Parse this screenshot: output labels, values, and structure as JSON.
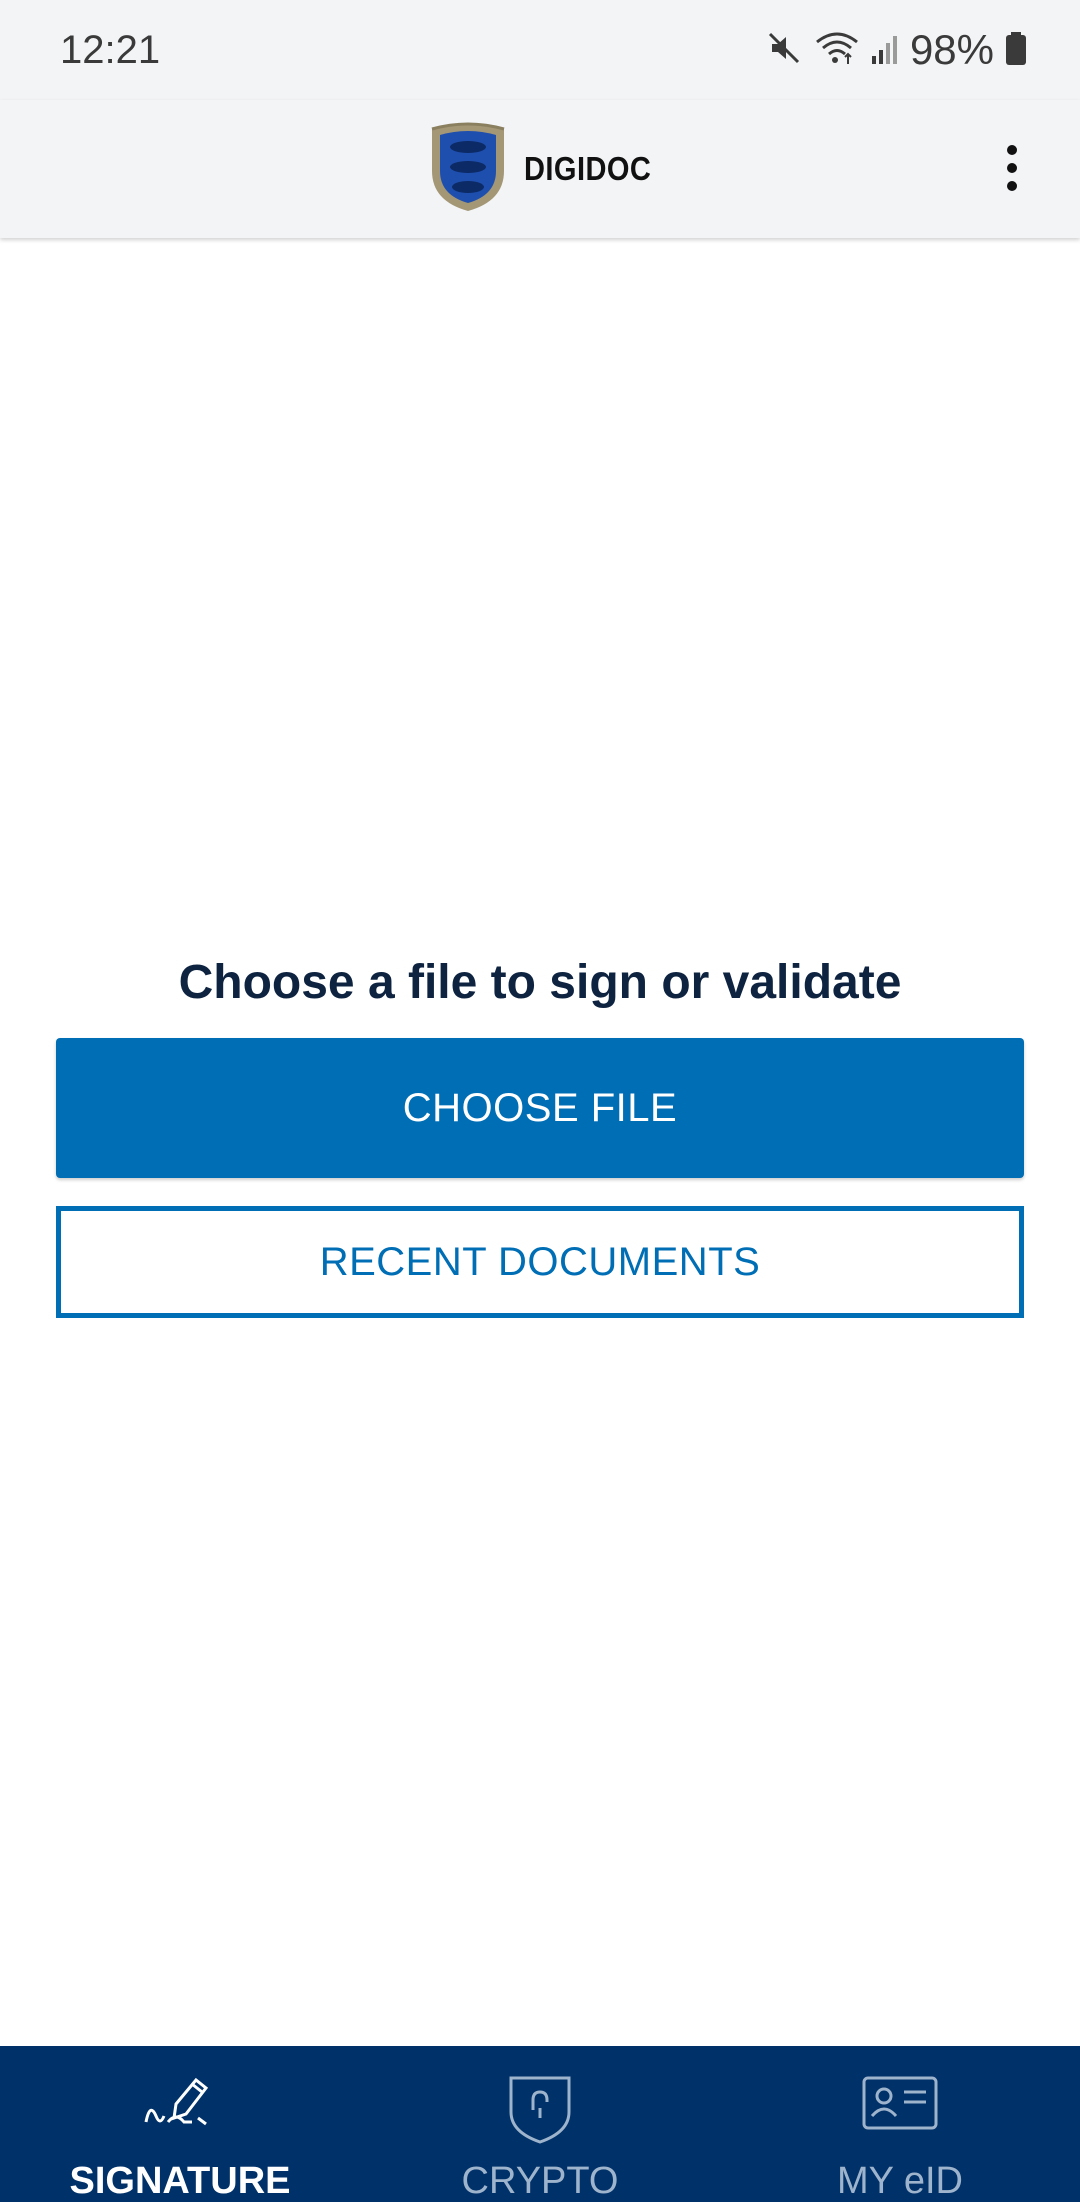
{
  "status_bar": {
    "time": "12:21",
    "battery": "98%",
    "icons": [
      "mute-icon",
      "wifi-icon",
      "signal-icon",
      "battery-icon"
    ]
  },
  "app_bar": {
    "title": "DIGIDOC",
    "logo": "estonian-coat-of-arms",
    "menu_icon": "more-vert-icon"
  },
  "main": {
    "heading": "Choose a file to sign or validate",
    "choose_file_label": "CHOOSE FILE",
    "recent_documents_label": "RECENT DOCUMENTS"
  },
  "bottom_nav": {
    "items": [
      {
        "label": "SIGNATURE",
        "icon": "signature-pen-icon",
        "active": true
      },
      {
        "label": "CRYPTO",
        "icon": "shield-lock-icon",
        "active": false
      },
      {
        "label": "MY eID",
        "icon": "id-card-icon",
        "active": false
      }
    ]
  },
  "colors": {
    "primary": "#006eb5",
    "nav_background": "#003168",
    "heading": "#0e2340",
    "bar_background": "#f3f4f6"
  }
}
